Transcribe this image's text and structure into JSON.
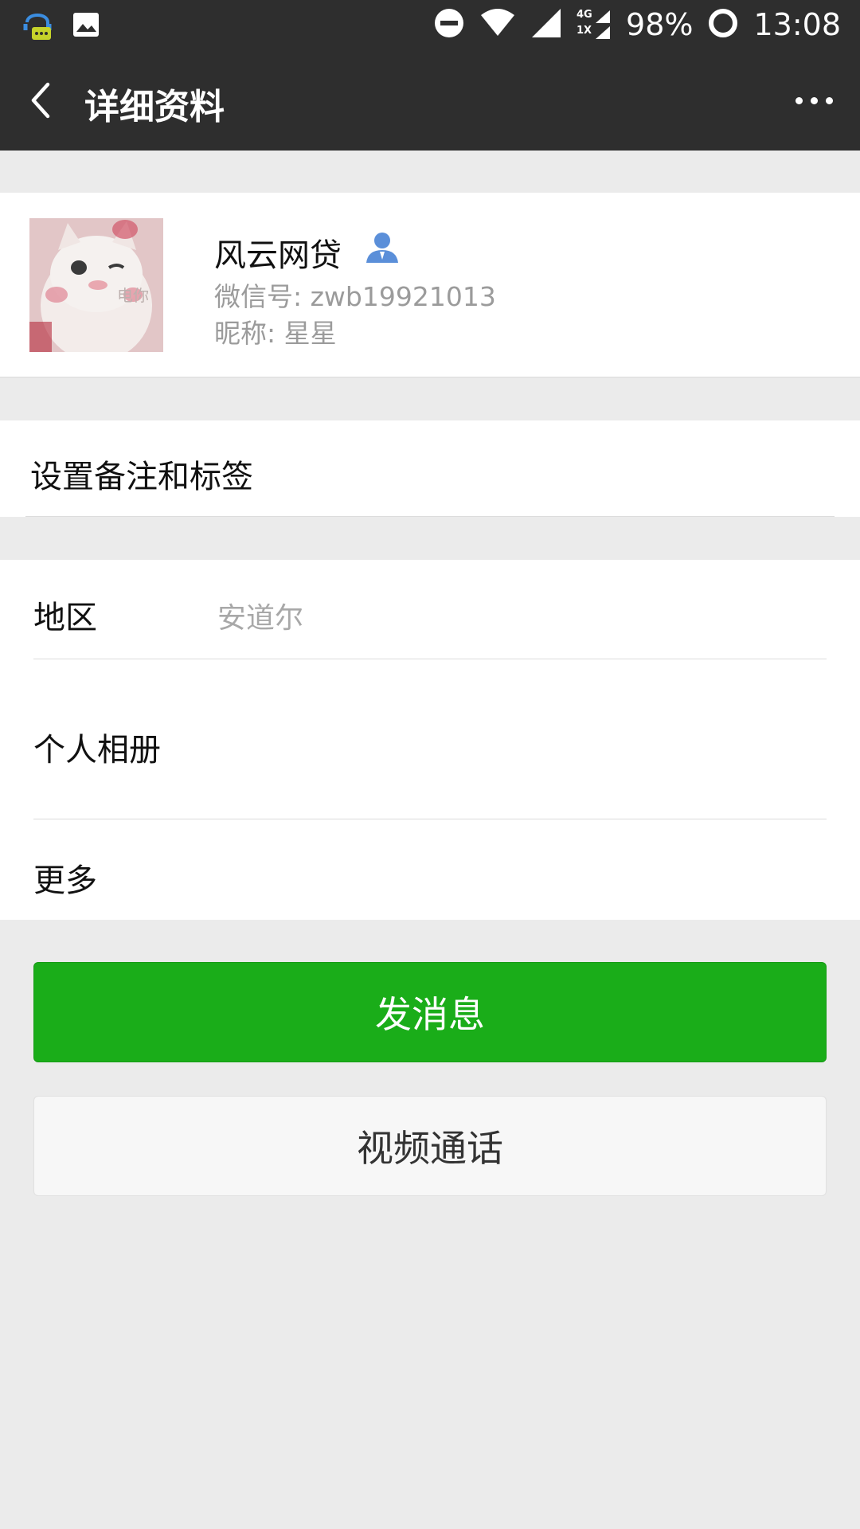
{
  "status_bar": {
    "battery": "98%",
    "time": "13:08",
    "network_label_top": "4G",
    "network_label_bottom": "1X",
    "icons": [
      "notification-app-icon",
      "image-icon",
      "do-not-disturb-icon",
      "wifi-icon",
      "signal-icon",
      "battery-ring-icon"
    ]
  },
  "app_bar": {
    "title": "详细资料",
    "back_icon": "chevron-left-icon",
    "more_icon": "more-dots-icon"
  },
  "profile": {
    "name": "风云网贷",
    "wechat_id": "微信号: zwb19921013",
    "nickname": "昵称: 星星",
    "avatar_watermark": "电你",
    "badge_icon": "contact-person-icon",
    "badge_color": "#5b8fd9"
  },
  "remark": {
    "label": "设置备注和标签"
  },
  "info": {
    "region_label": "地区",
    "region_value": "安道尔",
    "album_label": "个人相册",
    "more_label": "更多"
  },
  "actions": {
    "send_message": "发消息",
    "video_call": "视频通话"
  },
  "colors": {
    "header_bg": "#2e2e2e",
    "page_bg": "#ebebeb",
    "primary_green": "#1aad19"
  }
}
